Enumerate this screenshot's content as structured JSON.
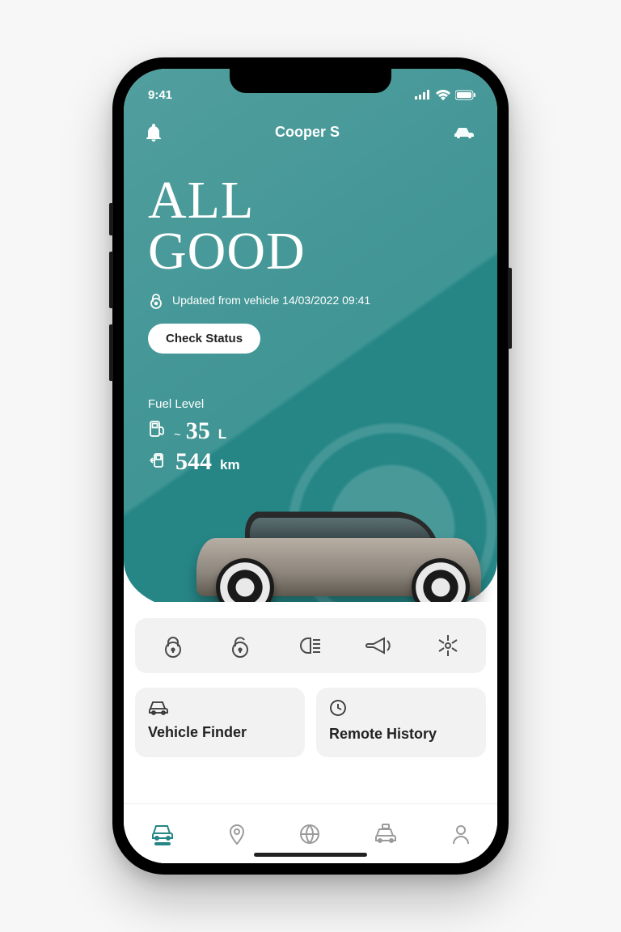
{
  "statusbar": {
    "time": "9:41"
  },
  "header": {
    "title": "Cooper S"
  },
  "hero": {
    "headline_line1": "ALL",
    "headline_line2": "GOOD",
    "updated_text": "Updated from vehicle 14/03/2022 09:41",
    "check_status_label": "Check Status"
  },
  "fuel": {
    "label": "Fuel Level",
    "approx_prefix": "~",
    "litres": "35",
    "litres_unit": "L",
    "range": "544",
    "range_unit": "km"
  },
  "remote_actions": {
    "lock": "lock",
    "unlock": "unlock",
    "lights": "lights",
    "horn": "horn",
    "climate": "climate"
  },
  "cards": {
    "finder": {
      "title": "Vehicle Finder"
    },
    "history": {
      "title": "Remote History"
    }
  },
  "tabs": {
    "vehicle": "vehicle",
    "map": "map",
    "explore": "explore",
    "service": "service",
    "profile": "profile"
  }
}
